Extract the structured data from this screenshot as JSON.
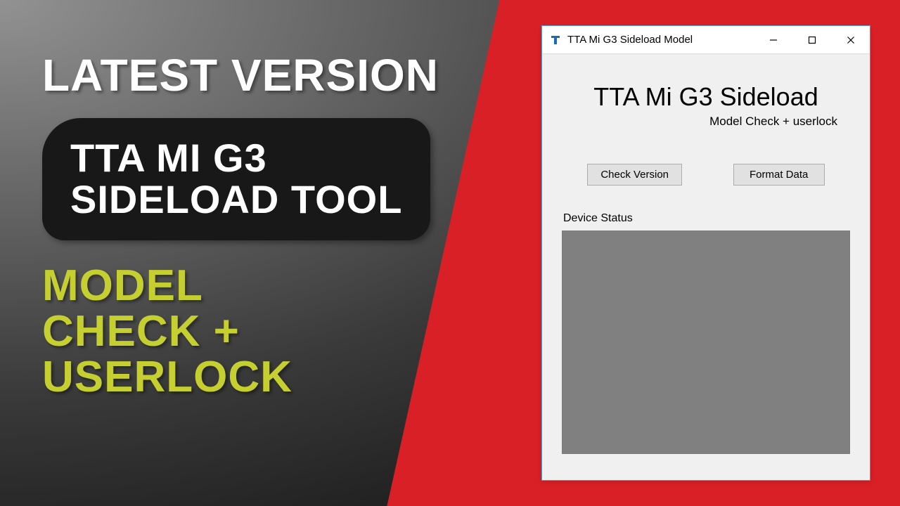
{
  "promo": {
    "headline": "LATEST VERSION",
    "badge_line1": "TTA MI G3",
    "badge_line2": "SIDELOAD TOOL",
    "subtext_line1": "MODEL",
    "subtext_line2": "CHECK +",
    "subtext_line3": "USERLOCK"
  },
  "window": {
    "title": "TTA Mi G3 Sideload Model",
    "icon_name": "app-letter-t-icon",
    "heading": "TTA Mi G3 Sideload",
    "subheading": "Model Check + userlock",
    "buttons": {
      "check_version": "Check Version",
      "format_data": "Format Data"
    },
    "status_label": "Device Status",
    "controls": {
      "minimize": "minimize",
      "maximize": "maximize",
      "close": "close"
    }
  },
  "colors": {
    "accent_red": "#d92027",
    "accent_yellowgreen": "#c5cf2f",
    "badge_bg": "#181818"
  }
}
